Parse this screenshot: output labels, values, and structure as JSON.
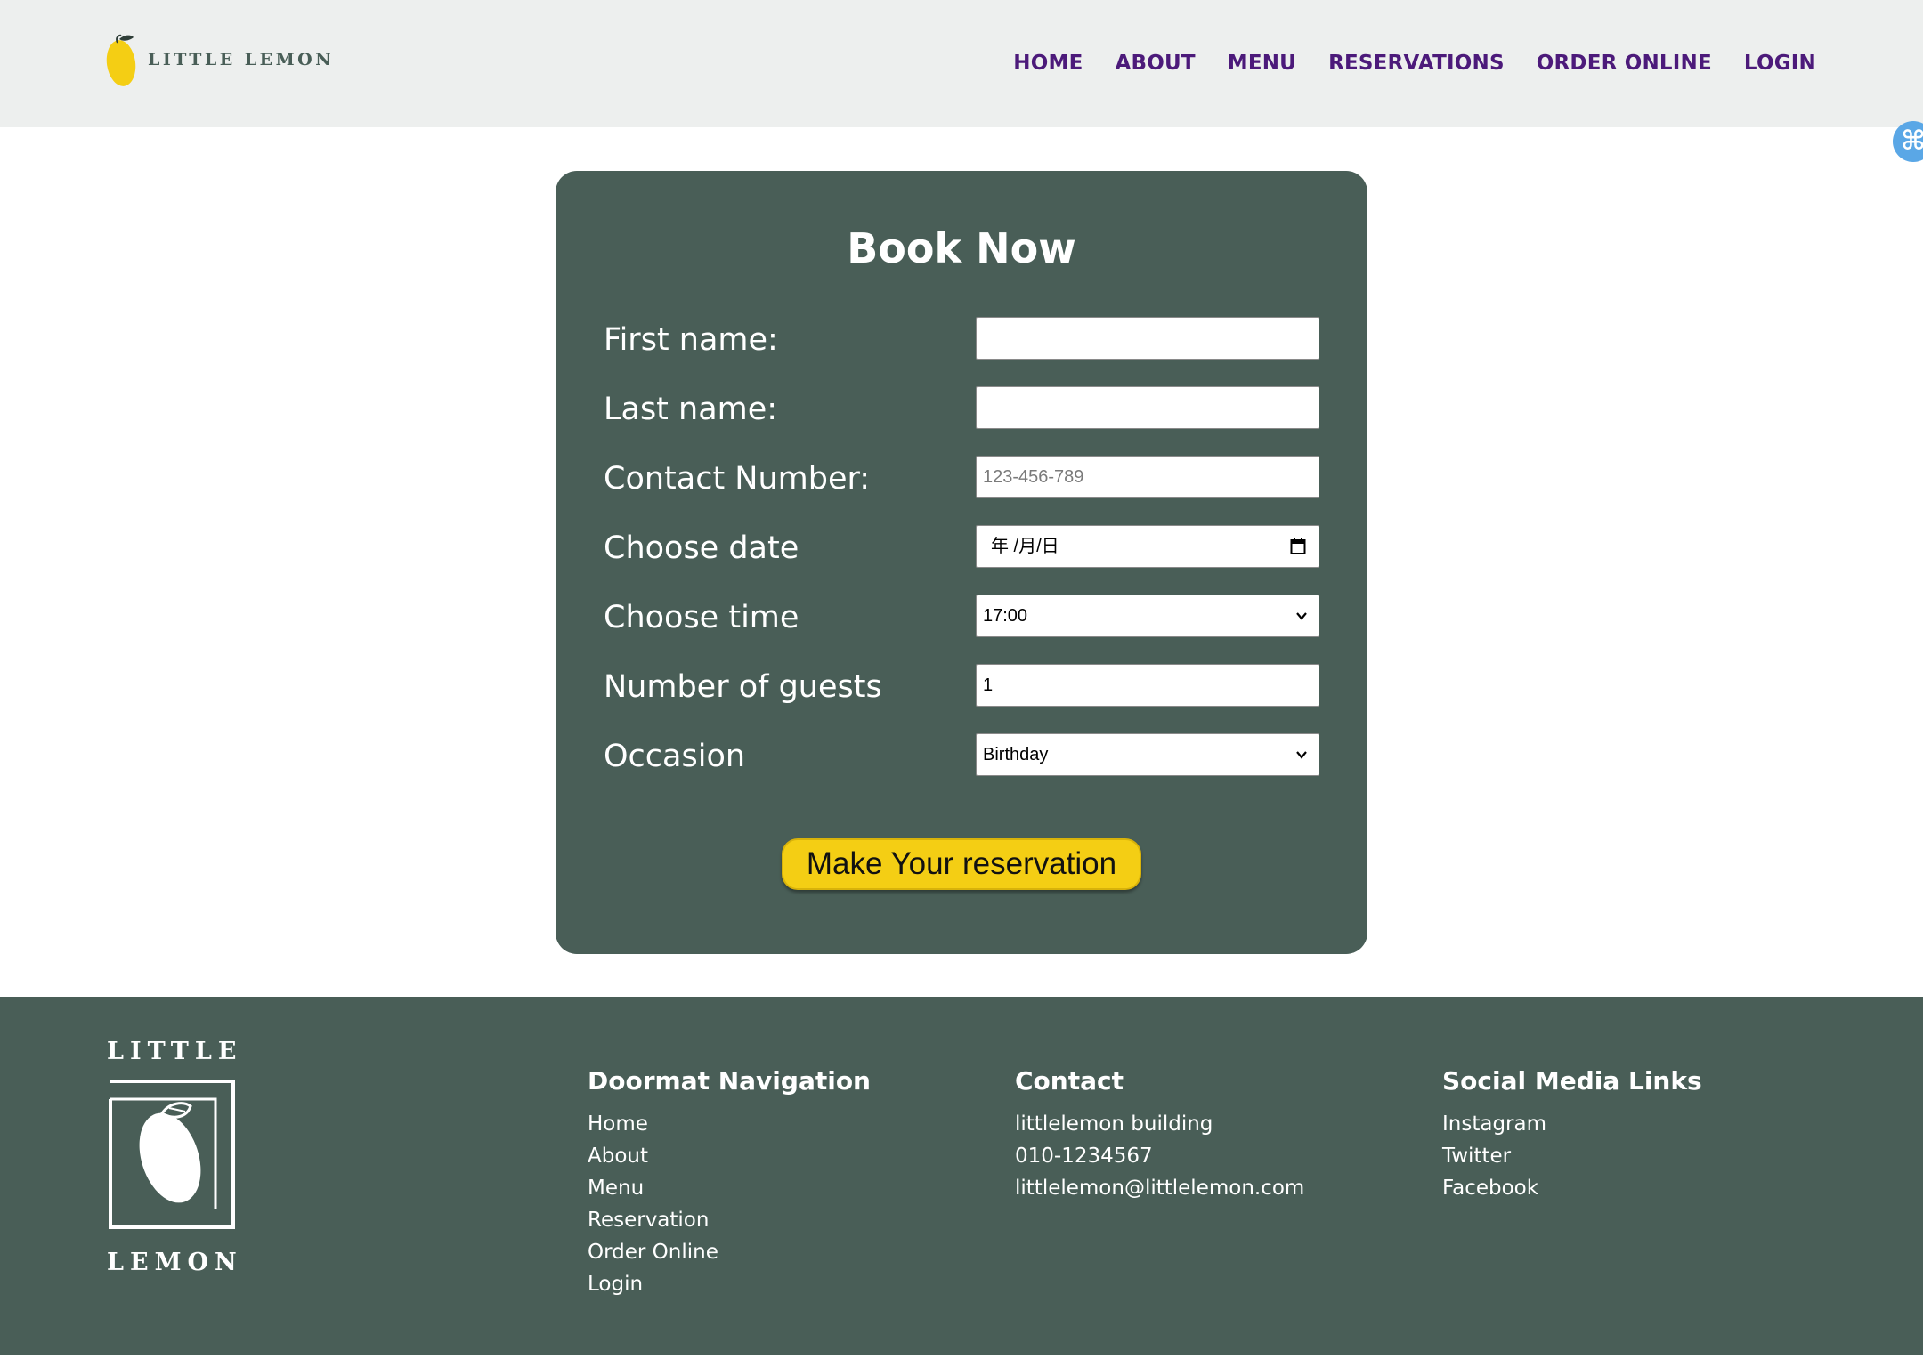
{
  "header": {
    "logo_text": "LITTLE LEMON",
    "nav": [
      "HOME",
      "ABOUT",
      "MENU",
      "RESERVATIONS",
      "ORDER ONLINE",
      "LOGIN"
    ]
  },
  "form": {
    "title": "Book Now",
    "fields": [
      {
        "label": "First name:",
        "value": "",
        "placeholder": ""
      },
      {
        "label": "Last name:",
        "value": "",
        "placeholder": ""
      },
      {
        "label": "Contact Number:",
        "value": "",
        "placeholder": "123-456-789"
      },
      {
        "label": "Choose date",
        "value": "",
        "placeholder": "年 /月/日"
      },
      {
        "label": "Choose time",
        "value": "17:00",
        "placeholder": ""
      },
      {
        "label": "Number of guests",
        "value": "1",
        "placeholder": ""
      },
      {
        "label": "Occasion",
        "value": "Birthday",
        "placeholder": ""
      }
    ],
    "submit_label": "Make Your reservation"
  },
  "footer": {
    "logo_top": "LITTLE",
    "logo_bottom": "LEMON",
    "nav_title": "Doormat Navigation",
    "nav_items": [
      "Home",
      "About",
      "Menu",
      "Reservation",
      "Order Online",
      "Login"
    ],
    "contact_title": "Contact",
    "contact_items": [
      "littlelemon building",
      "010-1234567",
      "littlelemon@littlelemon.com"
    ],
    "social_title": "Social Media Links",
    "social_items": [
      "Instagram",
      "Twitter",
      "Facebook"
    ]
  },
  "side_badge": "⌘",
  "colors": {
    "primary_green": "#495e57",
    "accent_yellow": "#f4ce14",
    "nav_purple": "#4c1a7a",
    "header_bg": "#edefee"
  }
}
